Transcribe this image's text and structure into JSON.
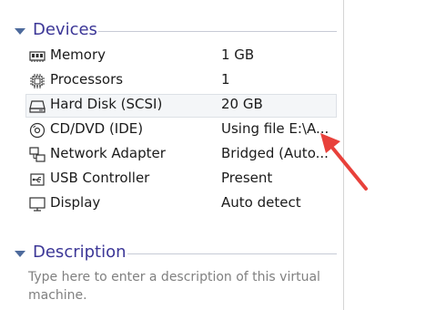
{
  "devices_section": {
    "title": "Devices"
  },
  "devices": [
    {
      "name": "Memory",
      "value": "1 GB",
      "icon": "memory-icon"
    },
    {
      "name": "Processors",
      "value": "1",
      "icon": "processor-icon"
    },
    {
      "name": "Hard Disk (SCSI)",
      "value": "20 GB",
      "icon": "hard-disk-icon"
    },
    {
      "name": "CD/DVD (IDE)",
      "value": "Using file E:\\A...",
      "icon": "cd-dvd-icon"
    },
    {
      "name": "Network Adapter",
      "value": "Bridged (Auto...",
      "icon": "network-adapter-icon"
    },
    {
      "name": "USB Controller",
      "value": "Present",
      "icon": "usb-icon"
    },
    {
      "name": "Display",
      "value": "Auto detect",
      "icon": "display-icon"
    }
  ],
  "selected_device": "Hard Disk (SCSI)",
  "description_section": {
    "title": "Description",
    "placeholder": "Type here to enter a description of this virtual machine."
  },
  "annotation": {
    "arrow_color": "#e8413b"
  },
  "colors": {
    "section_title": "#3c3797",
    "triangle": "#4d6a9c"
  }
}
